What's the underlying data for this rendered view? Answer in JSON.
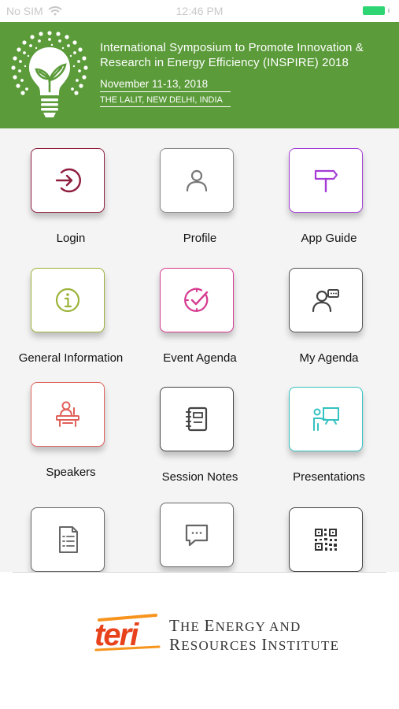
{
  "status_bar": {
    "carrier": "No SIM",
    "time": "12:46 PM",
    "battery_color": "#2ed573"
  },
  "header": {
    "title": "International Symposium to Promote Innovation & Research in Energy Efficiency (INSPIRE) 2018",
    "dates": "November 11-13, 2018",
    "venue": "THE LALIT, NEW DELHI, INDIA",
    "logo_icon": "lightbulb-leaf-icon",
    "bg_color": "#5b9b3a"
  },
  "menu": {
    "login": "Login",
    "profile": "Profile",
    "app_guide": "App Guide",
    "general_information": "General Information",
    "event_agenda": "Event Agenda",
    "my_agenda": "My Agenda",
    "speakers": "Speakers",
    "session_notes": "Session Notes",
    "presentations": "Presentations"
  },
  "footer": {
    "logo_text": "teri",
    "line1_cap1": "T",
    "line1_rest1": "HE ",
    "line1_cap2": "E",
    "line1_rest2": "NERGY AND",
    "line2_cap1": "R",
    "line2_rest1": "ESOURCES ",
    "line2_cap2": "I",
    "line2_rest2": "NSTITUTE"
  }
}
